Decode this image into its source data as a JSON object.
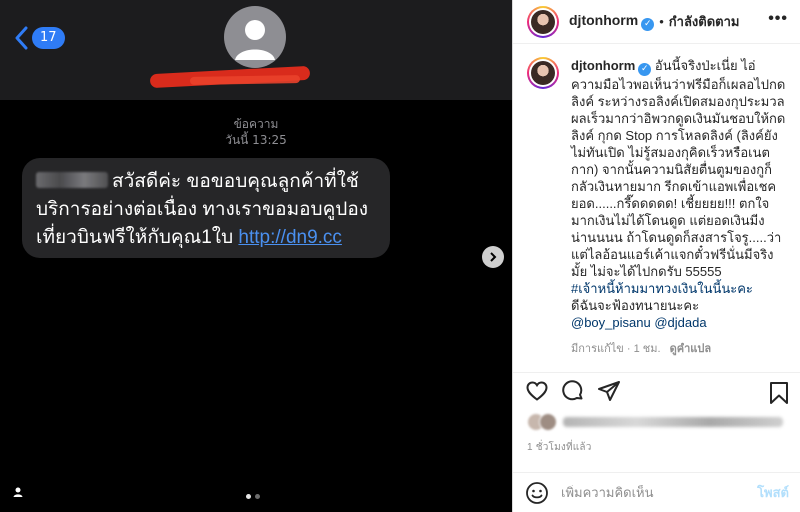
{
  "sms": {
    "back_count": "17",
    "meta_label": "ข้อความ",
    "meta_time": "วันนี้ 13:25",
    "message_text": "สวัสดีค่ะ ขอขอบคุณลูกค้าที่ใช้บริการอย่างต่อเนื่อง ทางเราขอมอบคูปองเที่ยวบินฟรีให้กับคุณ1ใบ",
    "message_link": "http://dn9.cc"
  },
  "instagram": {
    "username": "djtonhorm",
    "follow_status": "กำลังติดตาม",
    "caption_user": "djtonhorm",
    "caption_text": "อันนี้จริงป่ะเนี่ย ไอ่ความมือไวพอเห็นว่าฟรีมือก็เผลอไปกดลิงค์ ระหว่างรอลิงค์เปิดสมองกุประมวลผลเร็วมากว่าอิพวกดูดเงินมันชอบให้กดลิงค์ กุกด Stop การโหลดลิงค์ (ลิงค์ยังไม่ทันเปิด ไม่รู้สมองกุคิดเร็วหรือเนตกาก) จากนั้นความนิสัยตื่นตูมของกูก็กลัวเงินหายมาก รีกดเข้าแอพเพื่อเชคยอด......กรี๊ดดดดด! เชี้ยยยย!!! ตกใจมากเงินไม่ได้โดนดูด แต่ยอดเงินมีงน่านนนน ถ้าโดนดูดก็สงสารโจรู.....ว่าแต่ไลอ้อนแอร์เค้าแจกตั๋วฟรีนั่นมีจริงมั้ย ไม่จะได้ไปกดรับ 55555",
    "hashtag": "#เจ้าหนี้ห้ามมาทวงเงินในนี้นะคะ",
    "caption_tail": "ดีฉันจะฟ้องทนายนะคะ",
    "mention_1": "@boy_pisanu",
    "mention_2": "@djdada",
    "edited_label": "มีการแก้ไข · 1 ชม.",
    "translate_label": "ดูคำแปล",
    "time_ago": "1 ชั่วโมงที่แล้ว",
    "comment_placeholder": "เพิ่มความคิดเห็น",
    "post_label": "โพสต์"
  },
  "colors": {
    "ios_blue": "#2f7cf6",
    "link_blue": "#4a90f0",
    "ig_verified": "#3897f0",
    "ig_post_disabled": "#b2dffc",
    "redaction_red": "#d92b1c"
  },
  "icons": [
    "chevron-left-icon",
    "contact-avatar-icon",
    "arrow-right-icon",
    "heart-icon",
    "comment-icon",
    "share-icon",
    "bookmark-icon",
    "emoji-icon",
    "more-icon",
    "verified-icon"
  ]
}
